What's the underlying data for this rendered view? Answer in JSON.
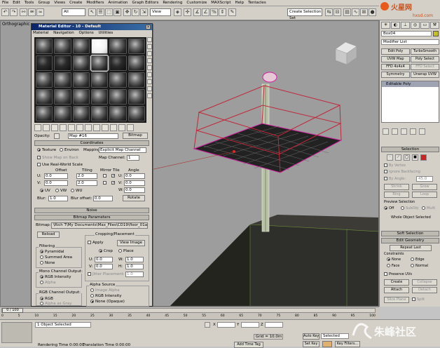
{
  "menubar": [
    "File",
    "Edit",
    "Tools",
    "Group",
    "Views",
    "Create",
    "Modifiers",
    "Animation",
    "Graph Editors",
    "Rendering",
    "Customize",
    "MAXScript",
    "Help",
    "Tentacles"
  ],
  "toolbar": {
    "filter": "All",
    "ref_coord": "View",
    "named_sel": "Create Selection Set"
  },
  "watermark": {
    "top_logo": "火星网",
    "top_url": "hxsd.com",
    "bottom_logo": "朱峰社区"
  },
  "viewport": {
    "label": "Orthographic"
  },
  "material_editor": {
    "title": "Material Editor - 10 - Default",
    "menu": [
      "Material",
      "Navigation",
      "Options",
      "Utilities"
    ],
    "opacity_label": "Opacity:",
    "map_name": "Map #16",
    "map_type": "Bitmap",
    "rollouts": {
      "coordinates": "Coordinates",
      "noise": "Noise",
      "bitmap_params": "Bitmap Parameters"
    },
    "coords": {
      "texture": "Texture",
      "environ": "Environ",
      "mapping_label": "Mapping:",
      "mapping": "Explicit Map Channel",
      "show_map_on_back": "Show Map on Back",
      "map_channel_label": "Map Channel:",
      "map_channel": "1",
      "use_real_world": "Use Real-World Scale",
      "offset_hdr": "Offset",
      "tiling_hdr": "Tiling",
      "mirror_tile_hdr": "Mirror Tile",
      "angle_hdr": "Angle",
      "u_label": "U:",
      "v_label": "V:",
      "w_label": "W:",
      "u_offset": "0.0",
      "v_offset": "0.0",
      "u_tiling": "2.0",
      "v_tiling": "2.0",
      "u_angle": "0.0",
      "v_angle": "0.0",
      "w_angle": "0.0",
      "uv": "UV",
      "vw": "VW",
      "wu": "WU",
      "blur_label": "Blur:",
      "blur": "1.0",
      "blur_offset_label": "Blur offset:",
      "blur_offset": "0.0",
      "rotate": "Rotate"
    },
    "bitmap": {
      "label": "Bitmap:",
      "path": "\\Rich T\\My Documents\\Max_Files\\CD19\\floor_01a.jpg",
      "reload": "Reload",
      "cropping_title": "Cropping/Placement",
      "apply": "Apply",
      "view_image": "View Image",
      "crop": "Crop",
      "place": "Place",
      "u": "0.0",
      "v": "0.0",
      "w": "1.0",
      "h": "1.0",
      "jitter": "Jitter Placement:",
      "jitter_val": "1.0",
      "filtering_title": "Filtering",
      "pyramidal": "Pyramidal",
      "summed_area": "Summed Area",
      "none": "None",
      "mono_title": "Mono Channel Output:",
      "rgb_intensity": "RGB Intensity",
      "alpha": "Alpha",
      "alpha_source_title": "Alpha Source",
      "image_alpha": "Image Alpha",
      "alpha_rgb_intensity": "RGB Intensity",
      "none_opaque": "None (Opaque)",
      "rgb_out_title": "RGB Channel Output:",
      "rgb": "RGB",
      "alpha_as_gray": "Alpha as Gray"
    }
  },
  "command_panel": {
    "object_name": "Box04",
    "modifier_list": "Modifier List",
    "mod_buttons": [
      "Edit Poly",
      "TurboSmooth",
      "UVW Map",
      "Poly Select",
      "FFD 4x4x4",
      "FFD Select",
      "Symmetry",
      "Unwrap UVW"
    ],
    "stack_item": "Editable Poly",
    "selection": {
      "title": "Selection",
      "by_vertex": "By Vertex",
      "ignore_backfacing": "Ignore Backfacing",
      "by_angle": "By Angle:",
      "by_angle_val": "45.0",
      "shrink": "Shrink",
      "grow": "Grow",
      "ring": "Ring",
      "loop": "Loop",
      "preview_title": "Preview Selection",
      "off": "Off",
      "subobj": "SubObj",
      "multi": "Multi",
      "whole_object": "Whole Object Selected"
    },
    "soft_selection": "Soft Selection",
    "edit_geometry": {
      "title": "Edit Geometry",
      "repeat_last": "Repeat Last",
      "constraints": "Constraints",
      "none": "None",
      "edge": "Edge",
      "face": "Face",
      "normal": "Normal",
      "preserve_uvs": "Preserve UVs",
      "create": "Create",
      "collapse": "Collapse",
      "attach": "Attach",
      "detach": "Detach",
      "slice_plane": "Slice Plane",
      "split": "Split",
      "slice": "Slice",
      "reset_plane": "Reset Plane",
      "quickslice": "QuickSlice",
      "cut": "Cut"
    }
  },
  "timeline": {
    "frame": "0 / 100",
    "ticks": [
      "0",
      "5",
      "10",
      "15",
      "20",
      "25",
      "30",
      "35",
      "40",
      "45",
      "50",
      "55",
      "60",
      "65",
      "70",
      "75",
      "80",
      "85",
      "90",
      "95",
      "100"
    ]
  },
  "status": {
    "selected": "1 Object Selected",
    "render_time": "Rendering Time  0:00:00",
    "translation_time": "Translation Time  0:00:00",
    "x_label": "X",
    "y_label": "Y",
    "z_label": "Z",
    "grid": "Grid = 10.0m",
    "auto_key": "Auto Key",
    "selected_dd": "Selected",
    "set_key": "Set Key",
    "key_filters": "Key Filters...",
    "add_time_tag": "Add Time Tag"
  }
}
